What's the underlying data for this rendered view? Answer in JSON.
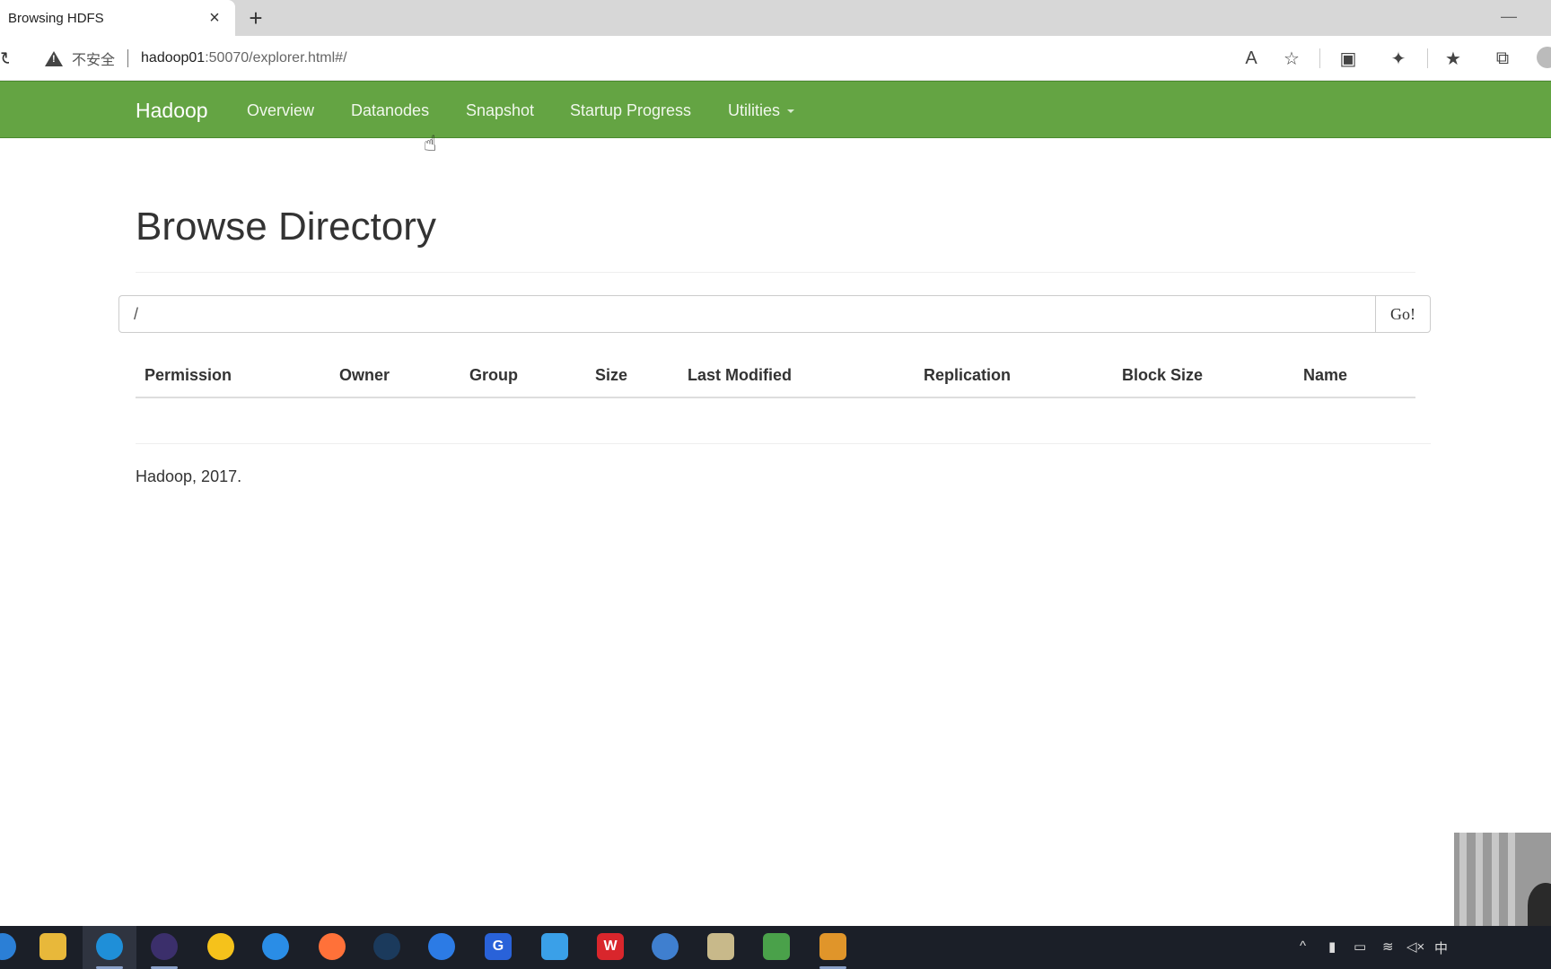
{
  "browser": {
    "tab_title": "Browsing HDFS",
    "tab_close": "×",
    "new_tab": "+",
    "minimize": "—",
    "reload": "↻",
    "security_label": "不安全",
    "url_host": "hadoop01",
    "url_rest": ":50070/explorer.html#/",
    "toolbar_icons": [
      "read-aloud-icon",
      "add-favorite-icon",
      "collections-icon",
      "extensions-icon",
      "favorites-icon",
      "split-screen-icon"
    ]
  },
  "navbar": {
    "brand": "Hadoop",
    "items": [
      "Overview",
      "Datanodes",
      "Snapshot",
      "Startup Progress",
      "Utilities"
    ]
  },
  "page": {
    "title": "Browse Directory",
    "path_value": "/",
    "go_label": "Go!"
  },
  "table": {
    "columns": [
      "Permission",
      "Owner",
      "Group",
      "Size",
      "Last Modified",
      "Replication",
      "Block Size",
      "Name"
    ],
    "rows": []
  },
  "footer": {
    "text": "Hadoop, 2017."
  },
  "taskbar": {
    "apps": [
      "start-icon",
      "file-explorer-icon",
      "edge-icon",
      "eclipse-icon",
      "kuwo-icon",
      "qq-browser-icon",
      "firefox-icon",
      "steam-icon",
      "sogou-icon",
      "g-app-icon",
      "snip-tool-icon",
      "wps-icon",
      "vpn-globe-icon",
      "control-panel-icon",
      "spreadsheet-icon",
      "vm-icon"
    ],
    "tray_ime": "中"
  },
  "colors": {
    "navbar": "#64a443",
    "taskbar": "#1b1f28"
  }
}
